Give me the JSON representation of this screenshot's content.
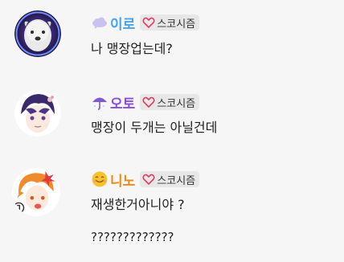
{
  "messages": [
    {
      "nickname": "이로",
      "nick_color": "#4aa3e8",
      "emoji": "cloud-icon",
      "badge": "스코시즘",
      "lines": [
        "나 맹장업는데?"
      ]
    },
    {
      "nickname": "오토",
      "nick_color": "#8a4fd6",
      "emoji": "umbrella-icon",
      "badge": "스코시즘",
      "lines": [
        "맹장이 두개는 아닐건데"
      ]
    },
    {
      "nickname": "니노",
      "nick_color": "#e88b1e",
      "emoji": "smiley-icon",
      "badge": "스코시즘",
      "lines": [
        "재생한거아니야 ?",
        "?????????????"
      ]
    }
  ]
}
